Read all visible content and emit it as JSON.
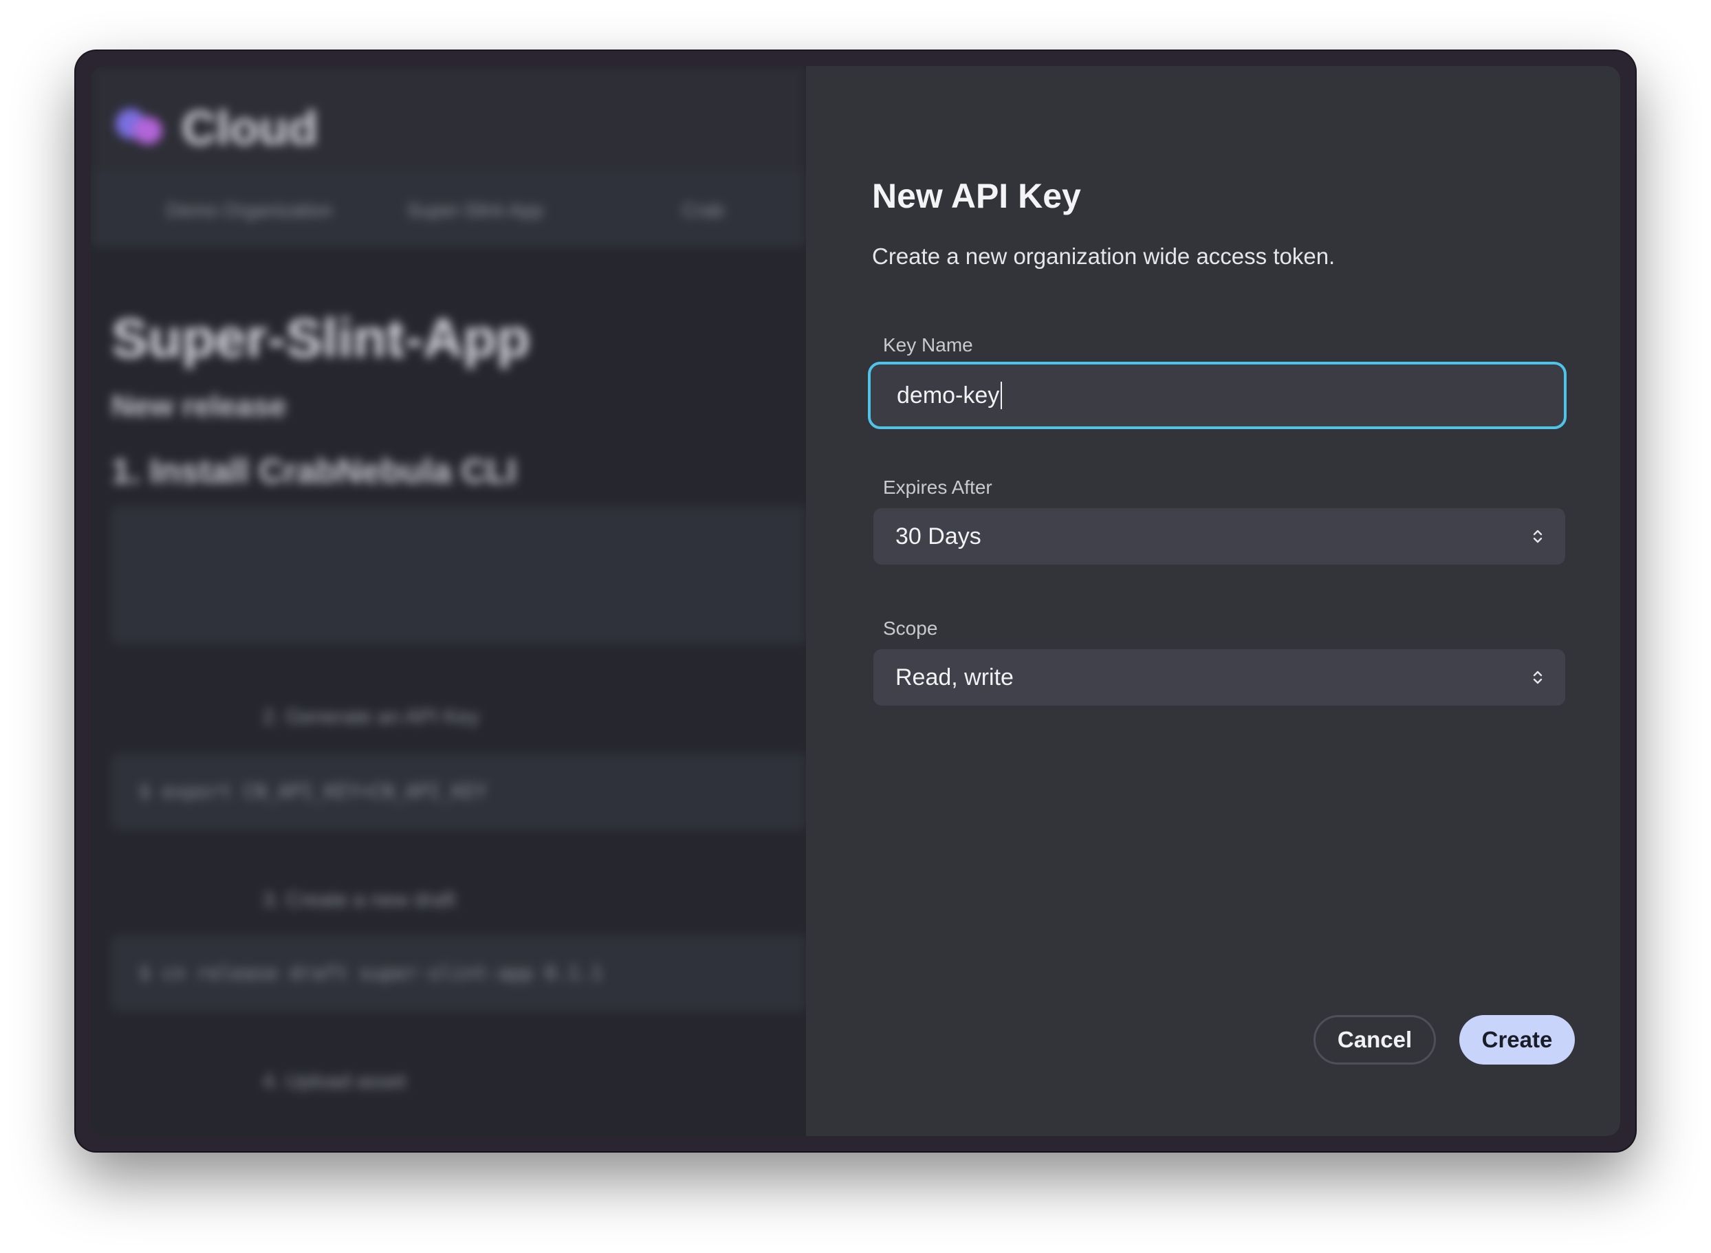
{
  "background_app": {
    "brand": "Cloud",
    "nav": [
      "Demo Organization",
      "Super-Slint-App",
      "Crab"
    ],
    "title": "Super-Slint-App",
    "subtitle": "New release",
    "step1": "1. Install CrabNebula CLI",
    "step2": "2. Generate an API Key",
    "step2_code": "$ export CN_API_KEY=CN_API_KEY",
    "step3": "3. Create a new draft",
    "step3_code": "$ cn release draft super-slint-app 0.1.1",
    "step4": "4. Upload asset"
  },
  "dialog": {
    "title": "New API Key",
    "description": "Create a new organization wide access token.",
    "key_name": {
      "label": "Key Name",
      "value": "demo-key"
    },
    "expires_after": {
      "label": "Expires After",
      "value": "30 Days"
    },
    "scope": {
      "label": "Scope",
      "value": "Read, write"
    },
    "cancel_label": "Cancel",
    "create_label": "Create"
  },
  "colors": {
    "focus_ring": "#4fc3e8",
    "primary_button": "#c9d4fb",
    "panel": "#33343a"
  }
}
